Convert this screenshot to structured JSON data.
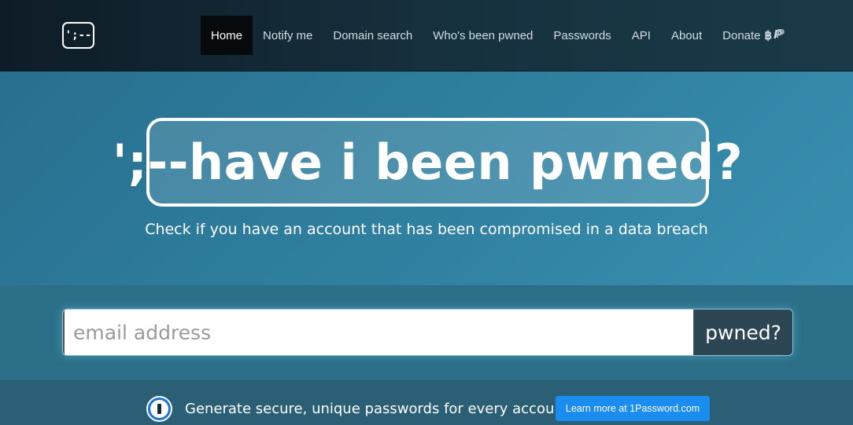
{
  "header": {
    "logo_text": "';--",
    "nav": [
      {
        "label": "Home",
        "active": true
      },
      {
        "label": "Notify me"
      },
      {
        "label": "Domain search"
      },
      {
        "label": "Who's been pwned"
      },
      {
        "label": "Passwords"
      },
      {
        "label": "API"
      },
      {
        "label": "About"
      },
      {
        "label": "Donate"
      }
    ],
    "donate_icons": [
      "bitcoin-icon",
      "paypal-icon"
    ]
  },
  "hero": {
    "title": "';--have i been pwned?",
    "subtitle": "Check if you have an account that has been compromised in a data breach"
  },
  "search": {
    "placeholder": "email address",
    "value": "",
    "button_label": "pwned?"
  },
  "promo": {
    "icon": "1password-icon",
    "text": "Generate secure, unique passwords for every account",
    "button_label": "Learn more at 1Password.com"
  },
  "colors": {
    "hero_bg": "#2f7f9e",
    "nav_bg": "#0e1c26",
    "active_nav_bg": "#060a0d",
    "button_dark": "#2c4753",
    "promo_button": "#1b8cf0"
  }
}
